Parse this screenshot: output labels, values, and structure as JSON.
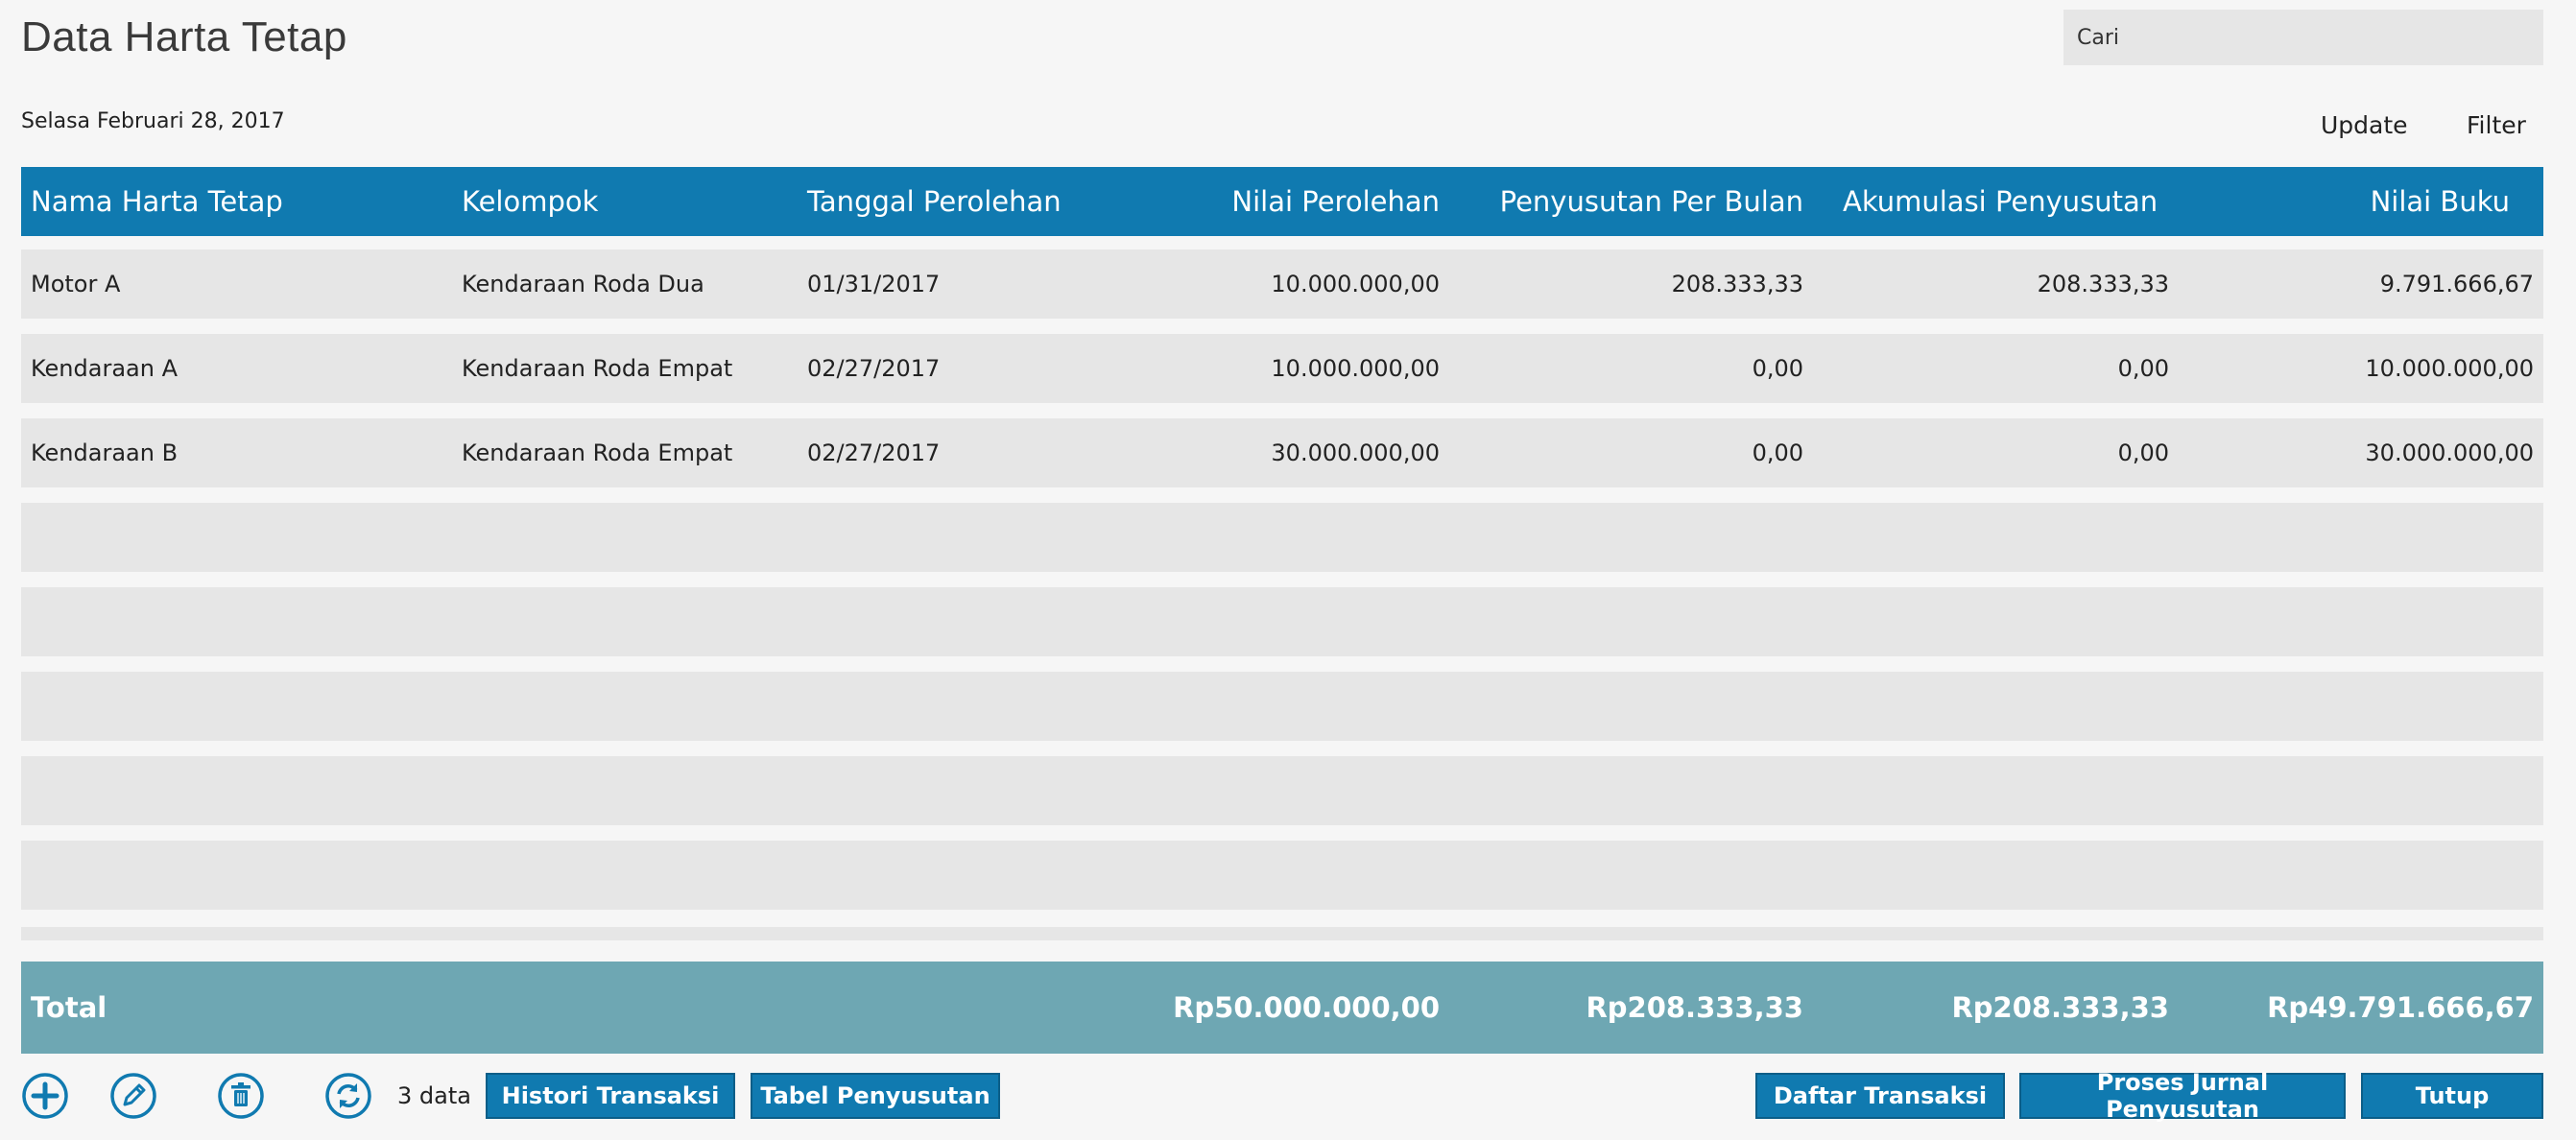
{
  "page": {
    "title": "Data Harta Tetap",
    "date": "Selasa Februari 28, 2017"
  },
  "search": {
    "placeholder": "Cari"
  },
  "top_links": {
    "update": "Update",
    "filter": "Filter"
  },
  "table": {
    "columns": [
      "Nama Harta Tetap",
      "Kelompok",
      "Tanggal Perolehan",
      "Nilai Perolehan",
      "Penyusutan Per Bulan",
      "Akumulasi Penyusutan",
      "Nilai Buku"
    ],
    "rows": [
      [
        "Motor A",
        "Kendaraan Roda Dua",
        "01/31/2017",
        "10.000.000,00",
        "208.333,33",
        "208.333,33",
        "9.791.666,67"
      ],
      [
        "Kendaraan A",
        "Kendaraan Roda Empat",
        "02/27/2017",
        "10.000.000,00",
        "0,00",
        "0,00",
        "10.000.000,00"
      ],
      [
        "Kendaraan B",
        "Kendaraan Roda Empat",
        "02/27/2017",
        "30.000.000,00",
        "0,00",
        "0,00",
        "30.000.000,00"
      ]
    ],
    "empty_rows": 5
  },
  "totals": {
    "label": "Total",
    "nilai_perolehan": "Rp50.000.000,00",
    "penyusutan_per_bulan": "Rp208.333,33",
    "akumulasi_penyusutan": "Rp208.333,33",
    "nilai_buku": "Rp49.791.666,67"
  },
  "footer": {
    "count": "3 data",
    "icons": [
      "plus-circle-icon",
      "pencil-icon",
      "trash-icon",
      "refresh-icon"
    ],
    "buttons": {
      "histori": "Histori Transaksi",
      "tabel": "Tabel Penyusutan",
      "daftar": "Daftar Transaksi",
      "proses": "Proses Jurnal Penyusutan",
      "tutup": "Tutup"
    }
  },
  "colors": {
    "accent": "#107ab0",
    "total_bar": "#6ea7b3",
    "row_bg": "#e6e6e6",
    "page_bg": "#f6f6f6"
  }
}
